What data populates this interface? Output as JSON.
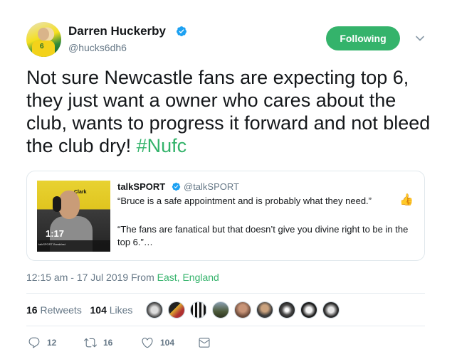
{
  "author": {
    "name": "Darren Huckerby",
    "handle": "@hucks6dh6",
    "jersey_number": "6"
  },
  "follow_button": {
    "label": "Following"
  },
  "tweet": {
    "text": "Not sure Newcastle fans are expecting top 6, they just want a owner who cares about the club, wants to progress it forward and not bleed the club dry! ",
    "hashtag": "#Nufc"
  },
  "quoted": {
    "name": "talkSPORT",
    "handle": "@talkSPORT",
    "line1": "“Bruce is a safe appointment and is probably what they need.”",
    "line1_emoji": "👍",
    "line2": "“The fans are fanatical but that doesn’t give you divine right to be in the top 6.”…",
    "video": {
      "duration": "1:17",
      "brand_text": "Clark",
      "caption_text": "talkSPORT Breakfast"
    }
  },
  "meta": {
    "time_prefix": "12:15 am - 17 Jul 2019 From ",
    "location": "East, England"
  },
  "stats": {
    "retweets_count": "16",
    "retweets_label": " Retweets",
    "likes_count": "104",
    "likes_label": " Likes"
  },
  "actions": {
    "replies": "12",
    "retweets": "16",
    "likes": "104"
  },
  "colors": {
    "accent": "#34b36b",
    "muted": "#657786",
    "verified": "#1da1f2"
  }
}
